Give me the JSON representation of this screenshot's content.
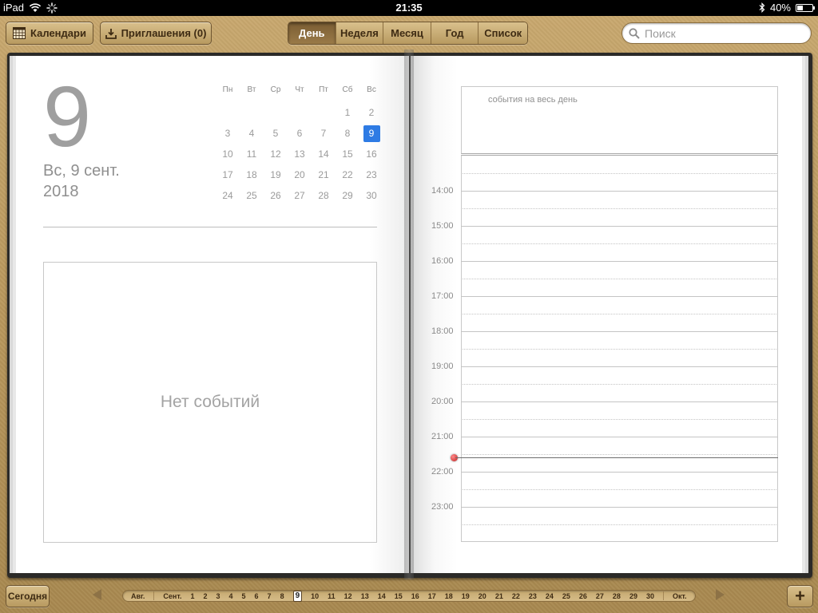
{
  "status_bar": {
    "device": "iPad",
    "time": "21:35",
    "battery": "40%",
    "battery_level": 0.4
  },
  "toolbar": {
    "calendars_label": "Календари",
    "invitations_label": "Приглашения (0)",
    "views": [
      "День",
      "Неделя",
      "Месяц",
      "Год",
      "Список"
    ],
    "active_view": "День",
    "search_placeholder": "Поиск"
  },
  "left_page": {
    "big_day": "9",
    "date_line1": "Вс, 9 сент.",
    "date_line2": "2018",
    "mini_calendar": {
      "weekdays": [
        "Пн",
        "Вт",
        "Ср",
        "Чт",
        "Пт",
        "Сб",
        "Вс"
      ],
      "weeks": [
        [
          "",
          "",
          "",
          "",
          "",
          "1",
          "2"
        ],
        [
          "3",
          "4",
          "5",
          "6",
          "7",
          "8",
          "9"
        ],
        [
          "10",
          "11",
          "12",
          "13",
          "14",
          "15",
          "16"
        ],
        [
          "17",
          "18",
          "19",
          "20",
          "21",
          "22",
          "23"
        ],
        [
          "24",
          "25",
          "26",
          "27",
          "28",
          "29",
          "30"
        ]
      ],
      "selected": "9"
    },
    "no_events": "Нет событий"
  },
  "right_page": {
    "all_day_label": "события на весь день",
    "hours": [
      "14:00",
      "15:00",
      "16:00",
      "17:00",
      "18:00",
      "19:00",
      "20:00",
      "21:00",
      "22:00",
      "23:00"
    ]
  },
  "bottom_bar": {
    "today_label": "Сегодня",
    "prev_month": "Авг.",
    "current_month": "Сент.",
    "next_month": "Окт.",
    "days": [
      "1",
      "2",
      "3",
      "4",
      "5",
      "6",
      "7",
      "8",
      "9",
      "10",
      "11",
      "12",
      "13",
      "14",
      "15",
      "16",
      "17",
      "18",
      "19",
      "20",
      "21",
      "22",
      "23",
      "24",
      "25",
      "26",
      "27",
      "28",
      "29",
      "30"
    ],
    "current_day": "9",
    "add_label": "+"
  },
  "colors": {
    "selected_blue": "#2e7be4",
    "now_red": "#c01d1d",
    "leather": "#b8975c"
  }
}
